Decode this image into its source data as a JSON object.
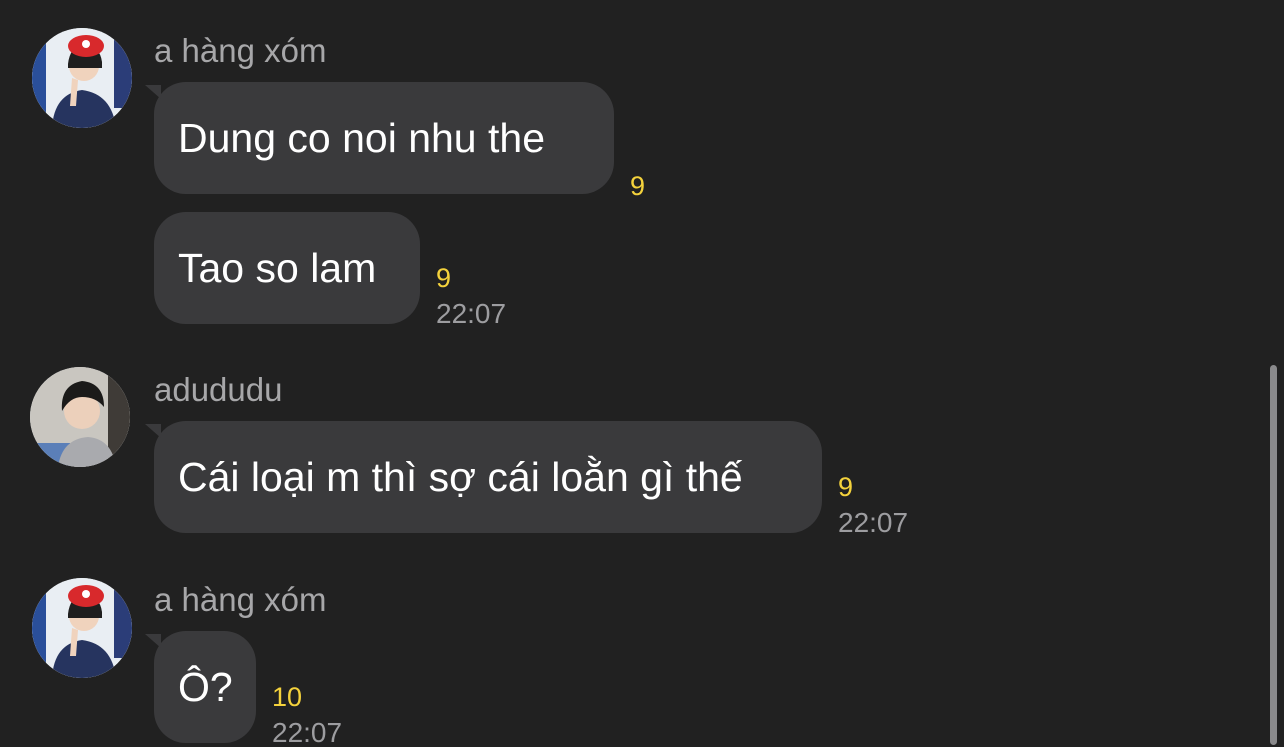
{
  "chat": {
    "groups": [
      {
        "sender": "a hàng xóm",
        "avatar_icon": "profile-photo-red-cap",
        "messages": [
          {
            "text": "Dung co noi nhu the",
            "unread_count": "9",
            "time": ""
          },
          {
            "text": "Tao so lam",
            "unread_count": "9",
            "time": "22:07"
          }
        ]
      },
      {
        "sender": "adududu",
        "avatar_icon": "profile-photo-dark-hair",
        "messages": [
          {
            "text": "Cái loại m thì sợ cái loằn gì thế",
            "unread_count": "9",
            "time": "22:07"
          }
        ]
      },
      {
        "sender": "a hàng xóm",
        "avatar_icon": "profile-photo-red-cap",
        "messages": [
          {
            "text": "Ô?",
            "unread_count": "10",
            "time": "22:07"
          }
        ]
      }
    ]
  },
  "colors": {
    "background": "#212121",
    "bubble": "#3a3a3c",
    "unread": "#f4d23c",
    "sender": "#a7a7a9",
    "time": "#9d9da0"
  }
}
